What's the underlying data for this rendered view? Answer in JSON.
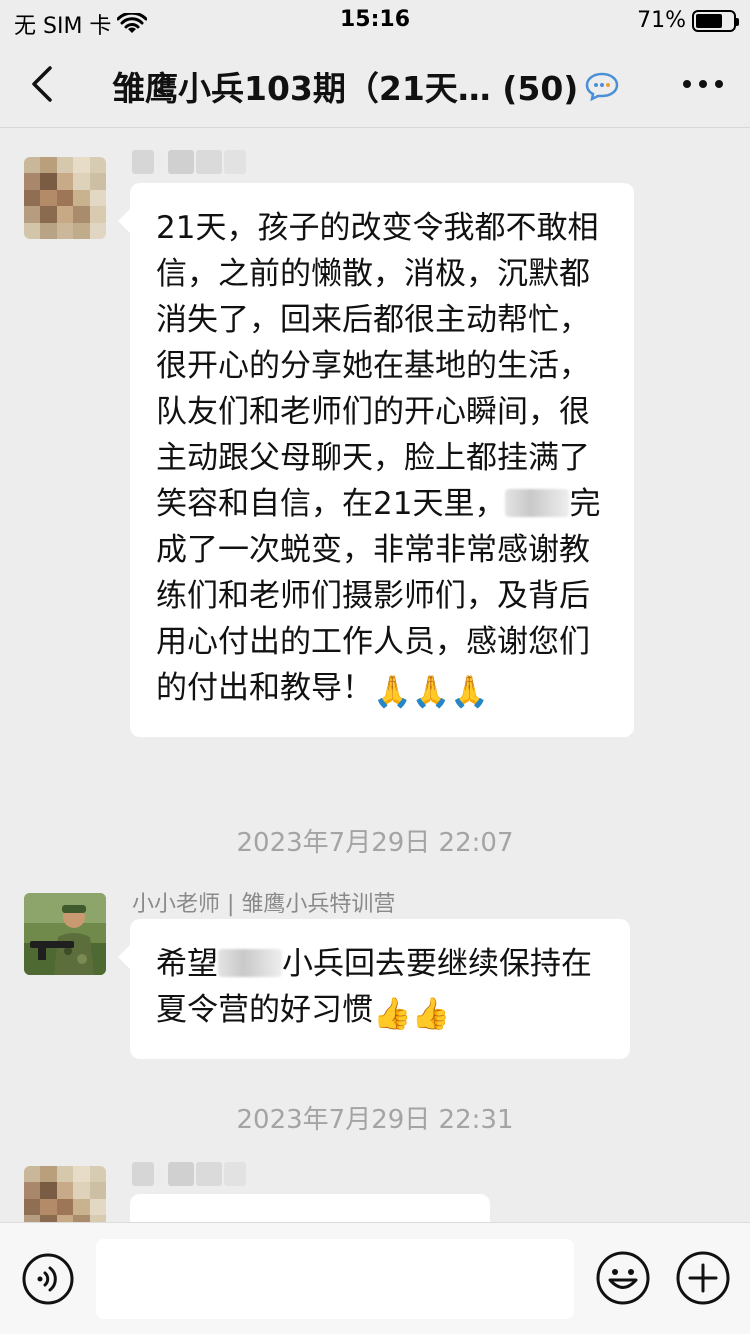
{
  "status_bar": {
    "carrier": "无 SIM 卡",
    "time": "15:16",
    "battery_percent": "71%",
    "battery_level": 0.71
  },
  "nav": {
    "title": "雏鹰小兵103期（21天… (50)",
    "back_icon": "chevron-left-icon",
    "more_icon": "more-dots-icon"
  },
  "messages": [
    {
      "sender": "",
      "text_parts": [
        "21天，孩子的改变令我都不敢相信，之前的懒散，消极，沉默都消失了，回来后都很主动帮忙，很开心的分享她在基地的生活，队友们和老师们的开心瞬间，很主动跟父母聊天，脸上都挂满了笑容和自信，在21天里，",
        "完成了一次蜕变，非常非常感谢教练们和老师们摄影师们，及背后用心付出的工作人员，感谢您们的付出和教导！"
      ],
      "emojis": "🙏🙏🙏"
    },
    {
      "timestamp": "2023年7月29日 22:07"
    },
    {
      "sender": "小小老师 | 雏鹰小兵特训营",
      "text_parts": [
        "希望",
        "小兵回去要继续保持在夏令营的好习惯"
      ],
      "emojis": "👍👍"
    },
    {
      "timestamp": "2023年7月29日 22:31"
    }
  ],
  "input_bar": {
    "placeholder": "",
    "voice_icon": "voice-icon",
    "emoji_icon": "emoji-face-icon",
    "plus_icon": "plus-circle-icon"
  },
  "colors": {
    "background": "#ededed",
    "bubble": "#ffffff",
    "timestamp": "#a4a4a4",
    "sender_name": "#8a8a8a"
  }
}
